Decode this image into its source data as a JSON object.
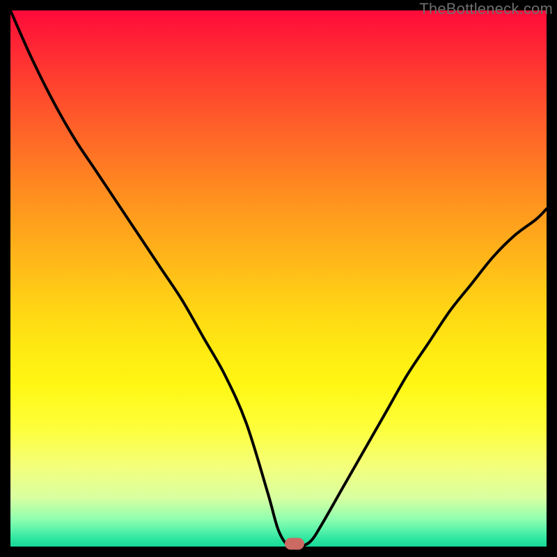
{
  "watermark": "TheBottleneck.com",
  "colors": {
    "curve": "#000000",
    "marker": "#cb6a63"
  },
  "chart_data": {
    "type": "line",
    "title": "",
    "xlabel": "",
    "ylabel": "",
    "xlim": [
      0,
      100
    ],
    "ylim": [
      0,
      100
    ],
    "grid": false,
    "legend": false,
    "description": "Bottleneck curve: percentage bottleneck (y) vs component balance position (x). V-shaped curve with minimum near x≈53 where bottleneck≈0.",
    "series": [
      {
        "name": "bottleneck-curve",
        "x": [
          0,
          4,
          8,
          12,
          16,
          20,
          24,
          28,
          32,
          36,
          40,
          44,
          48,
          50,
          52,
          54,
          56,
          58,
          62,
          66,
          70,
          74,
          78,
          82,
          86,
          90,
          94,
          98,
          100
        ],
        "y": [
          100,
          91,
          83,
          76,
          70,
          64,
          58,
          52,
          46,
          39,
          32,
          23,
          10,
          3,
          0,
          0,
          1,
          4,
          11,
          18,
          25,
          32,
          38,
          44,
          49,
          54,
          58,
          61,
          63
        ]
      }
    ],
    "marker": {
      "x": 53,
      "y": 0.5
    },
    "background_gradient": {
      "top": "#ff0a3a",
      "mid": "#ffe512",
      "bottom": "#16d997"
    }
  }
}
